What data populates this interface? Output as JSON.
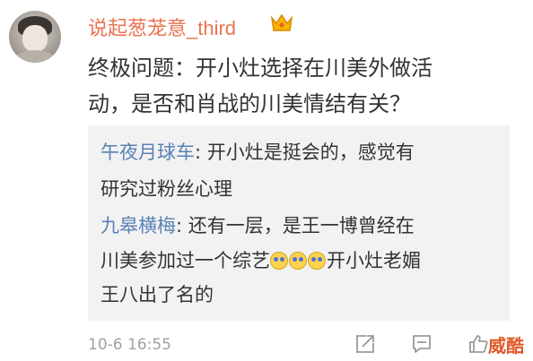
{
  "comment": {
    "username": "说起葱茏意_third",
    "text_lines": [
      "终极问题：开小灶选择在川美外做活",
      "动，是否和肖战的川美情结有关？"
    ],
    "time": "10-6 16:55"
  },
  "replies": [
    {
      "author": "午夜月球车",
      "lines": [
        ": 开小灶是挺会的，感觉有",
        "研究过粉丝心理"
      ]
    },
    {
      "author": "九皋横梅",
      "lines": [
        ": 还有一层，是王一博曾经在",
        "川美参加过一个综艺",
        "开小灶老媚",
        "王八出了名的"
      ]
    }
  ],
  "watermark": "威酷",
  "colors": {
    "username": "#eb7350",
    "reply_author": "#5a81b5",
    "text": "#333333",
    "reply_bg": "#f2f2f2",
    "time": "#a0a0a0"
  },
  "icons": [
    "crown-icon",
    "share-icon",
    "comment-icon",
    "like-icon",
    "grimace-emoji-icon"
  ]
}
